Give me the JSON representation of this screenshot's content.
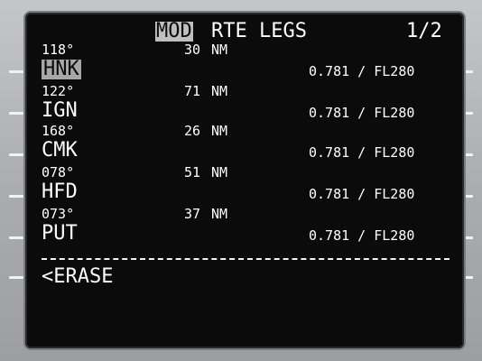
{
  "header": {
    "mod": "MOD",
    "title": "RTE LEGS",
    "page": "1/2"
  },
  "legs": [
    {
      "course": "118°",
      "distance": "30",
      "unit": "NM",
      "waypoint": "HNK",
      "speed_alt": "0.781 / FL280",
      "selected": true
    },
    {
      "course": "122°",
      "distance": "71",
      "unit": "NM",
      "waypoint": "IGN",
      "speed_alt": "0.781 / FL280",
      "selected": false
    },
    {
      "course": "168°",
      "distance": "26",
      "unit": "NM",
      "waypoint": "CMK",
      "speed_alt": "0.781 / FL280",
      "selected": false
    },
    {
      "course": "078°",
      "distance": "51",
      "unit": "NM",
      "waypoint": "HFD",
      "speed_alt": "0.781 / FL280",
      "selected": false
    },
    {
      "course": "073°",
      "distance": "37",
      "unit": "NM",
      "waypoint": "PUT",
      "speed_alt": "0.781 / FL280",
      "selected": false
    }
  ],
  "footer": {
    "erase": "<ERASE"
  }
}
